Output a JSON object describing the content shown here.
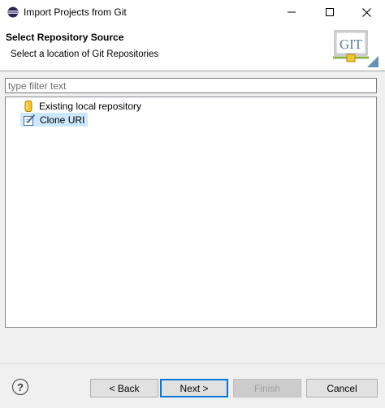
{
  "window": {
    "title": "Import Projects from Git",
    "controls": [
      "minimize-icon",
      "maximize-icon",
      "close-icon"
    ]
  },
  "header": {
    "title": "Select Repository Source",
    "description": "Select a location of Git Repositories",
    "logo_text": "GIT"
  },
  "filter": {
    "placeholder": "type filter text",
    "value": ""
  },
  "tree": {
    "items": [
      {
        "label": "Existing local repository",
        "icon": "local-repository-icon",
        "selected": false
      },
      {
        "label": "Clone URI",
        "icon": "clone-uri-icon",
        "selected": true
      }
    ]
  },
  "buttons": {
    "help": "?",
    "back": "< Back",
    "next": "Next >",
    "finish": "Finish",
    "cancel": "Cancel",
    "finish_enabled": false
  },
  "colors": {
    "selection": "#cce8ff",
    "default_button_border": "#0078d7"
  }
}
